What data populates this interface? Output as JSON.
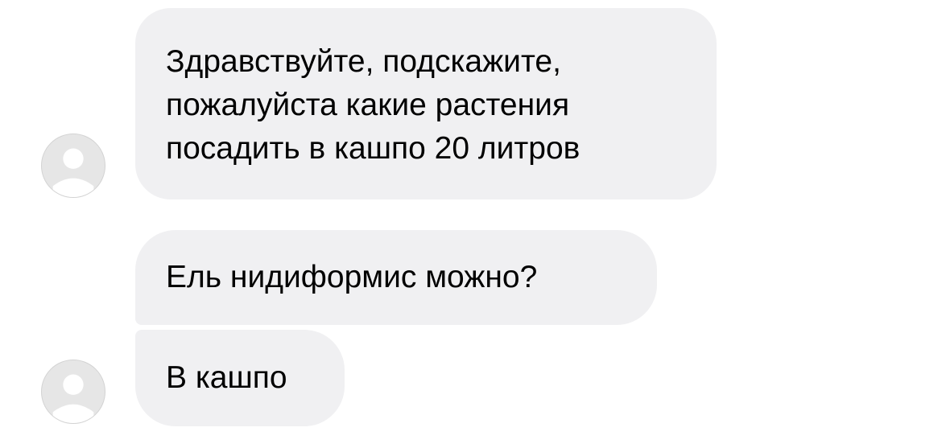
{
  "conversation": {
    "messages": [
      {
        "lines": [
          "Здравствуйте, подскажите,",
          "пожалуйста какие растения",
          "посадить в кашпо 20 литров"
        ]
      },
      {
        "lines": [
          "Ель нидиформис можно?"
        ]
      },
      {
        "lines": [
          "В кашпо"
        ]
      }
    ],
    "avatar_icon": "default-user-icon"
  },
  "colors": {
    "bubble_bg": "#f0f0f2",
    "avatar_bg": "#e6e6e6",
    "avatar_figure": "#ffffff",
    "text": "#000000"
  }
}
